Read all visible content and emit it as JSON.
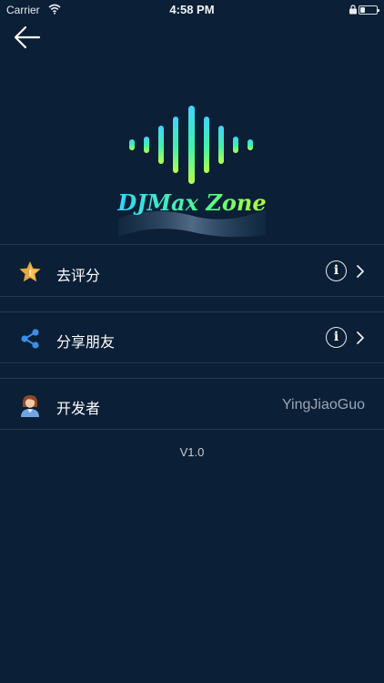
{
  "status_bar": {
    "carrier": "Carrier",
    "time": "4:58 PM"
  },
  "logo": {
    "text": "DJMax Zone"
  },
  "menu": {
    "items": [
      {
        "label": "去评分",
        "icon": "star-badge-icon"
      },
      {
        "label": "分享朋友",
        "icon": "share-icon"
      },
      {
        "label": "开发者",
        "icon": "developer-avatar-icon",
        "value": "YingJiaoGuo"
      }
    ],
    "info_symbol": "i"
  },
  "footer": {
    "version": "V1.0"
  },
  "colors": {
    "background": "#0b1f36",
    "divider": "#24384f",
    "share_icon": "#3b8eea",
    "star_icon": "#e8a73b"
  }
}
